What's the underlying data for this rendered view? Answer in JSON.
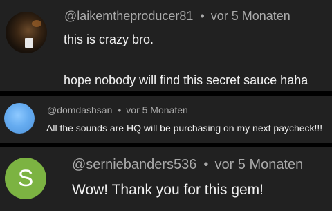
{
  "comments": [
    {
      "author": "@laikemtheproducer81",
      "time": "vor 5 Monaten",
      "lines": [
        "this is crazy bro.",
        "hope nobody will find this secret sauce haha"
      ],
      "avatar": {
        "type": "photo",
        "icon": "profile-photo"
      }
    },
    {
      "author": "@domdashsan",
      "time": "vor 5 Monaten",
      "lines": [
        "All the sounds are HQ will be purchasing on my next paycheck!!!"
      ],
      "avatar": {
        "type": "solid",
        "color": "#66acf0"
      }
    },
    {
      "author": "@serniebanders536",
      "time": "vor 5 Monaten",
      "lines": [
        "Wow! Thank you for this gem!"
      ],
      "avatar": {
        "type": "letter",
        "letter": "S",
        "color": "#7cb342"
      }
    }
  ],
  "separator": "•",
  "colors": {
    "panel": "#212121",
    "gap": "#000000",
    "meta": "#aaaaaa",
    "text": "#f1f1f1"
  }
}
